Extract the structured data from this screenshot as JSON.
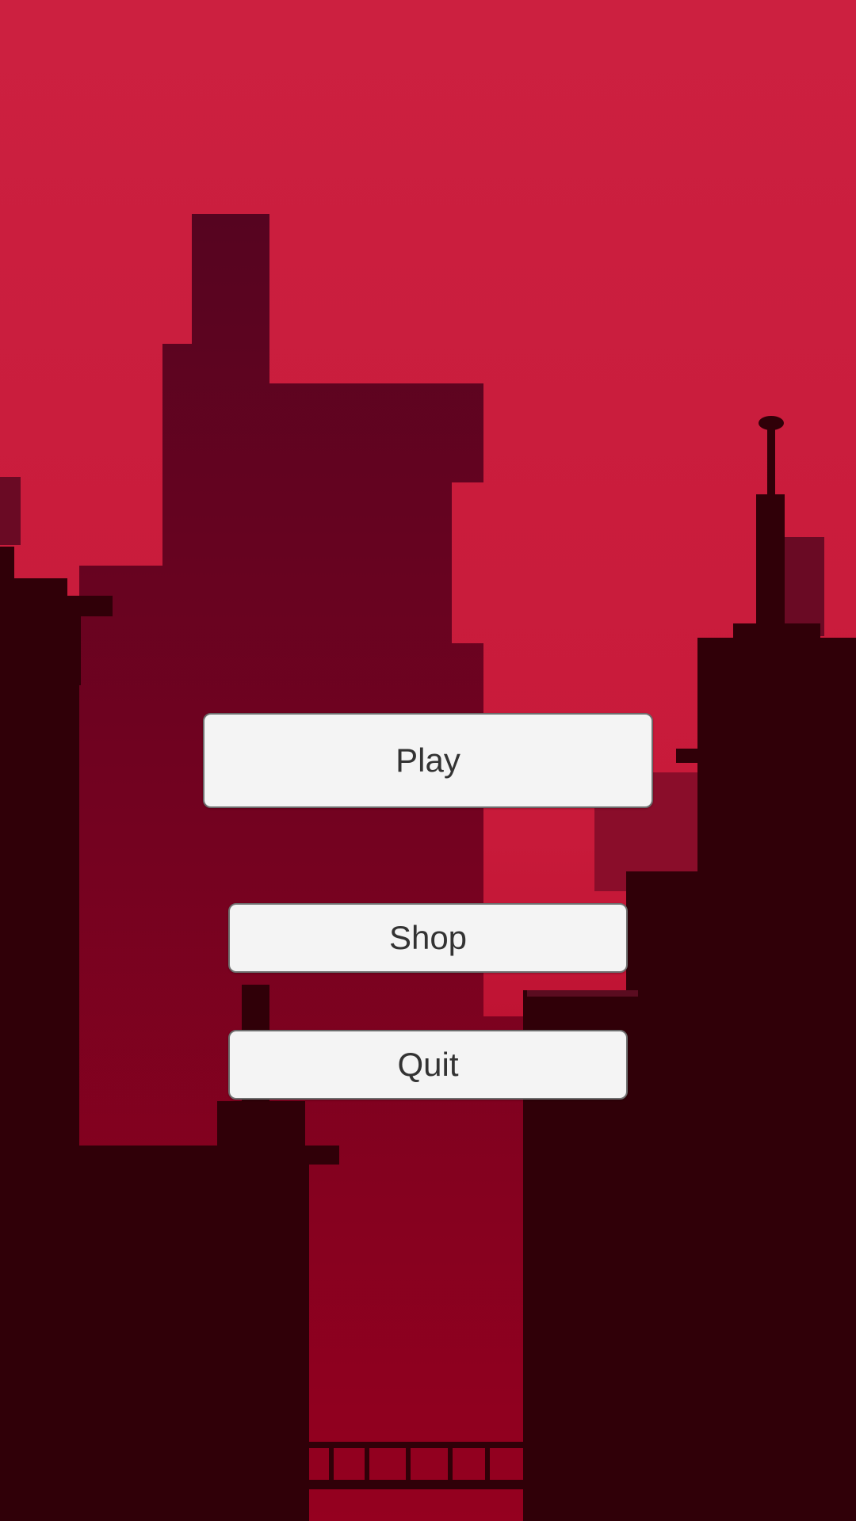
{
  "menu": {
    "play_label": "Play",
    "shop_label": "Shop",
    "quit_label": "Quit"
  },
  "colors": {
    "sky_top": "#cc2040",
    "sky_bottom": "#a5001f",
    "far_building": "#7a0a25",
    "mid_building": "#5c0520",
    "near_building": "#300008",
    "button_bg": "#f4f4f4",
    "button_text": "#333333"
  }
}
